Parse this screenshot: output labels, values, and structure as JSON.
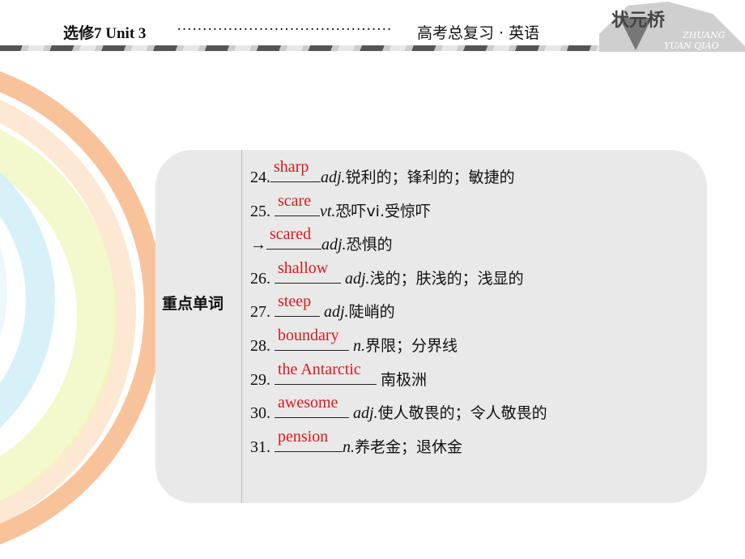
{
  "header": {
    "left": "选修7  Unit  3",
    "dots": "··········································",
    "right": "高考总复习 · 英语",
    "logo_text": "状元桥",
    "logo_sub1": "ZHUANG",
    "logo_sub2": "YUAN QIAO"
  },
  "section_label": "重点单词",
  "items": [
    {
      "num": "24.",
      "answer": "sharp",
      "pos": "adj.",
      "meaning": "锐利的；锋利的；敏捷的"
    },
    {
      "num": "25. ",
      "answer": "scare",
      "pos": "vt.",
      "meaning": "恐吓vi.受惊吓"
    },
    {
      "num": "→",
      "answer": "scared",
      "pos": "adj.",
      "meaning": "恐惧的"
    },
    {
      "num": "26. ",
      "answer": "shallow",
      "pos": " adj.",
      "meaning": "浅的；肤浅的；浅显的"
    },
    {
      "num": "27. ",
      "answer": "steep",
      "pos": " adj.",
      "meaning": "陡峭的"
    },
    {
      "num": "28. ",
      "answer": "boundary",
      "pos": " n.",
      "meaning": "界限；分界线"
    },
    {
      "num": "29. ",
      "answer": "the Antarctic",
      "pos": " ",
      "meaning": "南极洲"
    },
    {
      "num": "30. ",
      "answer": "awesome",
      "pos": " adj.",
      "meaning": "使人敬畏的；令人敬畏的"
    },
    {
      "num": "31. ",
      "answer": "pension",
      "pos": "n.",
      "meaning": "养老金；退休金"
    }
  ],
  "colors": {
    "answer": "#e0161a",
    "panel": "#e9e9e9"
  }
}
